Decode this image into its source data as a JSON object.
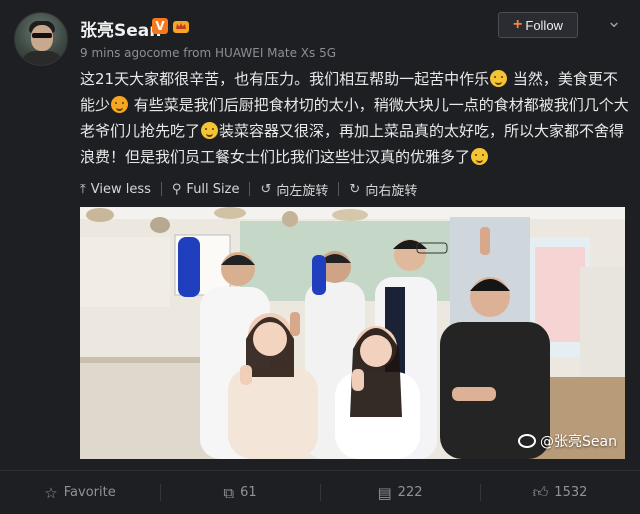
{
  "user": {
    "name": "张亮Sean",
    "verified_badge": "V",
    "meta": "9 mins agocome from HUAWEI Mate Xs 5G"
  },
  "header": {
    "follow_label": "Follow",
    "more_label": "⌄"
  },
  "post": {
    "segments": [
      "这21天大家都很辛苦，也有压力。我们相互帮助一起苦中作乐",
      " 当然，美食更不能少",
      " 有些菜是我们后厨把食材切的太小，稍微大块儿一点的食材都被我们几个大老爷们儿抢先吃了",
      "装菜容器又很深，再加上菜品真的太好吃，所以大家都不舍得浪费！但是我们员工餐女士们比我们这些壮汉真的优雅多了"
    ]
  },
  "toolbar": {
    "view_less": "View less",
    "full_size": "Full Size",
    "rotate_left": "向左旋转",
    "rotate_right": "向右旋转"
  },
  "photo": {
    "watermark": "@张亮Sean"
  },
  "footer": {
    "favorite_label": "Favorite",
    "repost_count": "61",
    "comment_count": "222",
    "like_count": "1532"
  },
  "colors": {
    "background": "#1d1f23",
    "accent": "#ff8140",
    "verified": "#f5781e",
    "muted_text": "#8f9298"
  },
  "icons": [
    "chevron-down-icon",
    "arrow-up-icon",
    "search-icon",
    "rotate-left-icon",
    "rotate-right-icon",
    "star-icon",
    "repost-icon",
    "comment-icon",
    "thumbs-up-icon"
  ]
}
